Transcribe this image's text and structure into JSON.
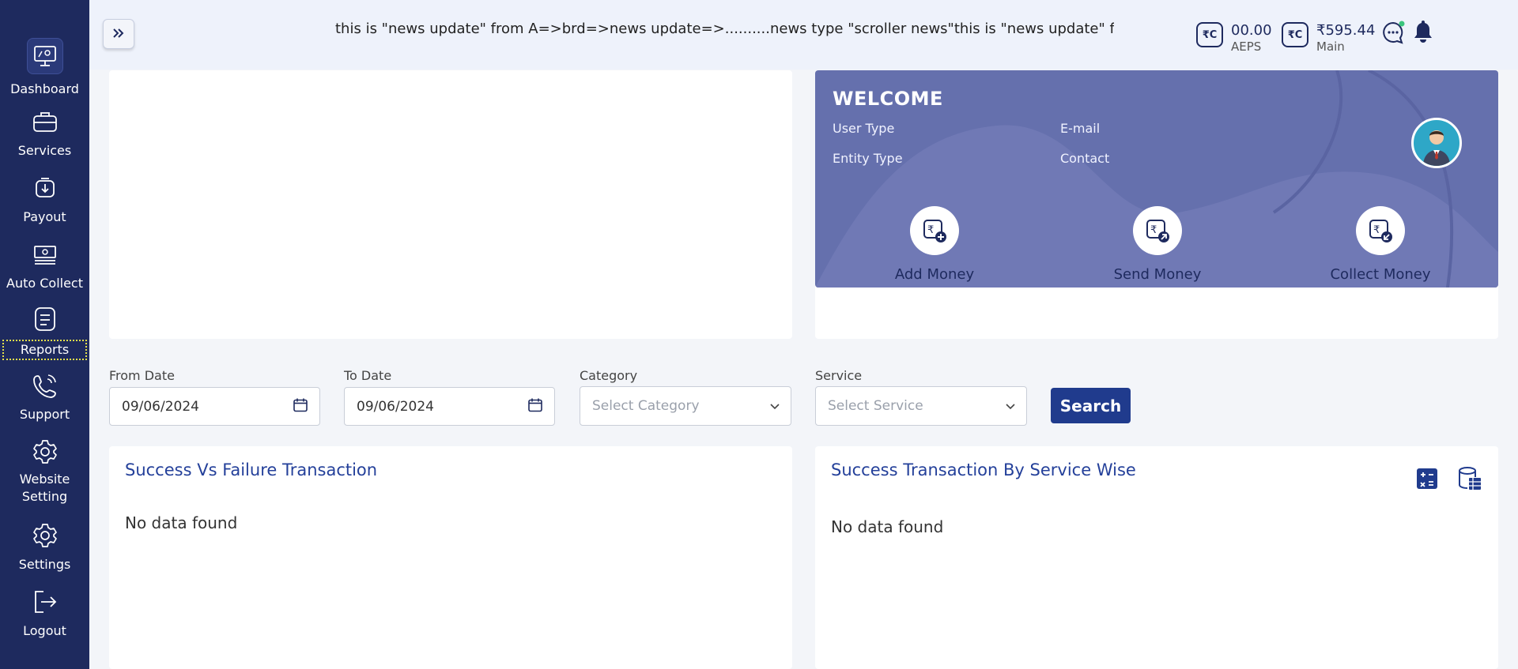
{
  "sidebar": {
    "items": [
      {
        "label": "Dashboard",
        "icon": "dashboard-icon"
      },
      {
        "label": "Services",
        "icon": "briefcase-icon"
      },
      {
        "label": "Payout",
        "icon": "payout-icon"
      },
      {
        "label": "Auto Collect",
        "icon": "cash-icon"
      },
      {
        "label": "Reports",
        "icon": "report-icon"
      },
      {
        "label": "Support",
        "icon": "phone-icon"
      },
      {
        "label": "Website Setting",
        "icon": "gear-icon"
      },
      {
        "label": "Settings",
        "icon": "gear-icon"
      },
      {
        "label": "Logout",
        "icon": "logout-icon"
      }
    ]
  },
  "header": {
    "news": "this is \"news update\" from A=>brd=>news update=>..........news type \"scroller news\"this is \"news update\" from A=>br",
    "wallets": [
      {
        "value": "00.00",
        "label": "AEPS"
      },
      {
        "value": "₹595.44",
        "label": "Main"
      }
    ]
  },
  "welcome": {
    "title": "WELCOME",
    "user_type": "User Type",
    "entity_type": "Entity Type",
    "email": "E-mail",
    "contact": "Contact",
    "actions": [
      {
        "label": "Add Money"
      },
      {
        "label": "Send Money"
      },
      {
        "label": "Collect Money"
      }
    ]
  },
  "filters": {
    "from_label": "From Date",
    "from_value": "09/06/2024",
    "to_label": "To Date",
    "to_value": "09/06/2024",
    "category_label": "Category",
    "category_placeholder": "Select Category",
    "service_label": "Service",
    "service_placeholder": "Select Service",
    "search_label": "Search"
  },
  "charts": {
    "left_title": "Success Vs Failure Transaction",
    "left_empty": "No data found",
    "right_title": "Success Transaction By Service Wise",
    "right_empty": "No data found"
  },
  "colors": {
    "sidebar": "#1e2a5e",
    "accent": "#203b8d",
    "welcome_bg": "#6570ad"
  }
}
